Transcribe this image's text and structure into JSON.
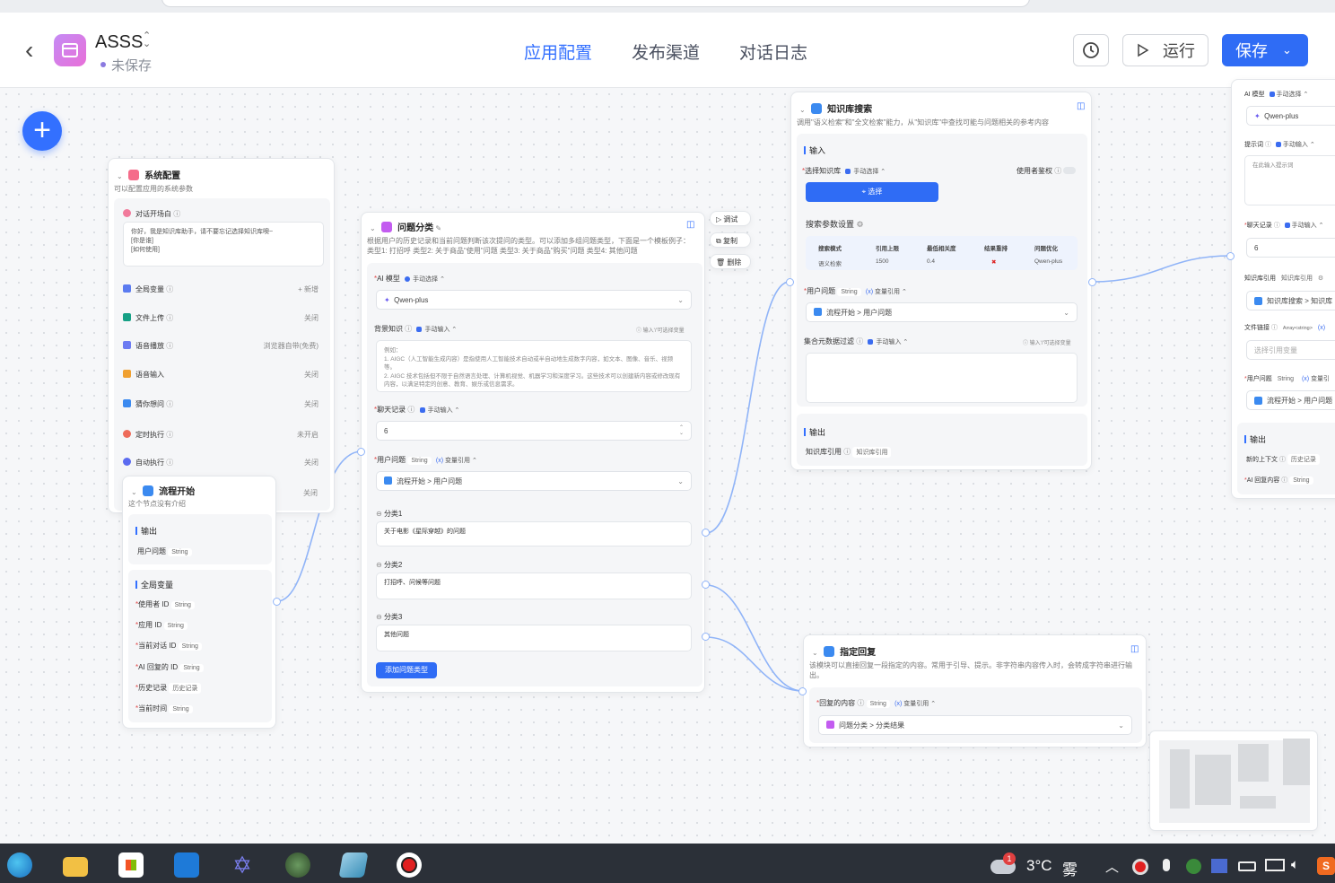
{
  "header": {
    "app_name": "ASSS",
    "save_status": "未保存",
    "tabs": [
      "应用配置",
      "发布渠道",
      "对话日志"
    ],
    "run_label": "运行",
    "save_label": "保存"
  },
  "system_node": {
    "title": "系统配置",
    "desc": "可以配置应用的系统参数",
    "welcome_label": "对话开场白",
    "welcome_text": "你好，我是知识库助手，请不要忘记选择知识库噢~\n[你是谁]\n[如何使用]",
    "rows": [
      {
        "label": "全局变量",
        "value": "+ 新增"
      },
      {
        "label": "文件上传",
        "value": "关闭"
      },
      {
        "label": "语音播放",
        "value": "浏览器自带(免费)"
      },
      {
        "label": "语音输入",
        "value": "关闭"
      },
      {
        "label": "猜你想问",
        "value": "关闭"
      },
      {
        "label": "定时执行",
        "value": "未开启"
      },
      {
        "label": "自动执行",
        "value": "关闭"
      }
    ],
    "last_value": "关闭"
  },
  "start_node": {
    "title": "流程开始",
    "desc": "这个节点没有介绍",
    "output_label": "输出",
    "output_item": "用户问题",
    "output_type": "String",
    "globals_label": "全局变量",
    "globals": [
      {
        "name": "使用者 ID",
        "type": "String"
      },
      {
        "name": "应用 ID",
        "type": "String"
      },
      {
        "name": "当前对话 ID",
        "type": "String"
      },
      {
        "name": "AI 回复的 ID",
        "type": "String"
      },
      {
        "name": "历史记录",
        "type": "历史记录"
      },
      {
        "name": "当前时间",
        "type": "String"
      }
    ]
  },
  "classify_node": {
    "title": "问题分类",
    "desc": "根据用户的历史记录和当前问题判断该次提问的类型。可以添加多组问题类型，下面是一个模板例子：\n类型1: 打招呼 类型2: 关于商品\"使用\"问题 类型3: 关于商品\"购买\"问题 类型4: 其他问题",
    "ai_model_label": "AI 模型",
    "manual_select": "手动选择",
    "model": "Qwen-plus",
    "bg_label": "背景知识",
    "manual_input": "手动输入",
    "bg_hint": "输入'/'可选择变量",
    "bg_placeholder": "例如：\n1. AIGC（人工智能生成内容）是指使用人工智能技术自动或半自动地生成数字内容，如文本、图像、音乐、视频等。\n2. AIGC 技术包括但不限于自然语言处理、计算机视觉、机器学习和深度学习。这些技术可以创建新内容或修改现有内容，以满足特定的创意、教育、娱乐或信息需求。",
    "history_label": "聊天记录",
    "history_value": "6",
    "question_label": "用户问题",
    "string_tag": "String",
    "var_ref": "变量引用",
    "question_ref": "流程开始 > 用户问题",
    "categories": [
      {
        "name": "分类1",
        "text": "关于电影《星际穿越》的问题"
      },
      {
        "name": "分类2",
        "text": "打招呼、问候等问题"
      },
      {
        "name": "分类3",
        "text": "其他问题"
      }
    ],
    "add_label": "添加问题类型"
  },
  "side_actions": [
    "调试",
    "复制",
    "删除"
  ],
  "kb_node": {
    "title": "知识库搜索",
    "desc": "调用\"语义检索\"和\"全文检索\"能力，从\"知识库\"中查找可能与问题相关的参考内容",
    "input_label": "输入",
    "select_kb_label": "选择知识库",
    "manual_select": "手动选择",
    "auth_label": "使用者鉴权",
    "select_btn": "选择",
    "params_label": "搜索参数设置",
    "table_headers": [
      "搜索模式",
      "引用上限",
      "最低相关度",
      "结果重排",
      "问题优化"
    ],
    "table_values": [
      "语义检索",
      "1500",
      "0.4",
      "✖",
      "Qwen-plus"
    ],
    "question_label": "用户问题",
    "string_tag": "String",
    "var_ref": "变量引用",
    "question_ref": "流程开始 > 用户问题",
    "filter_label": "集合元数据过滤",
    "manual_input": "手动输入",
    "filter_hint": "输入'/'可选择变量",
    "output_label": "输出",
    "output_item": "知识库引用",
    "output_tag": "知识库引用"
  },
  "reply_node": {
    "title": "指定回复",
    "desc": "该模块可以直接回复一段指定的内容。常用于引导、提示。非字符串内容传入时，会转成字符串进行输出。",
    "content_label": "回复的内容",
    "string_tag": "String",
    "var_ref": "变量引用",
    "ref": "问题分类 > 分类结果"
  },
  "ai_node": {
    "ai_model_label": "AI 模型",
    "manual_select": "手动选择",
    "model": "Qwen-plus",
    "prompt_label": "提示词",
    "manual_input": "手动输入",
    "prompt_placeholder": "在此输入提示词",
    "history_label": "聊天记录",
    "history_value": "6",
    "kb_label": "知识库引用",
    "kb_tag": "知识库引用",
    "kb_ref": "知识库搜索 > 知识库",
    "file_label": "文件链接",
    "file_tag": "Array<string>",
    "file_placeholder": "选择引用变量",
    "question_label": "用户问题",
    "string_tag": "String",
    "var_ref": "变量引",
    "question_ref": "流程开始 > 用户问题",
    "output_label": "输出",
    "outputs": [
      {
        "name": "新的上下文",
        "type": "历史记录"
      },
      {
        "name": "AI 回复内容",
        "type": "String"
      }
    ]
  },
  "taskbar": {
    "temp": "3°C",
    "weather": "雾",
    "notif_count": "1"
  }
}
